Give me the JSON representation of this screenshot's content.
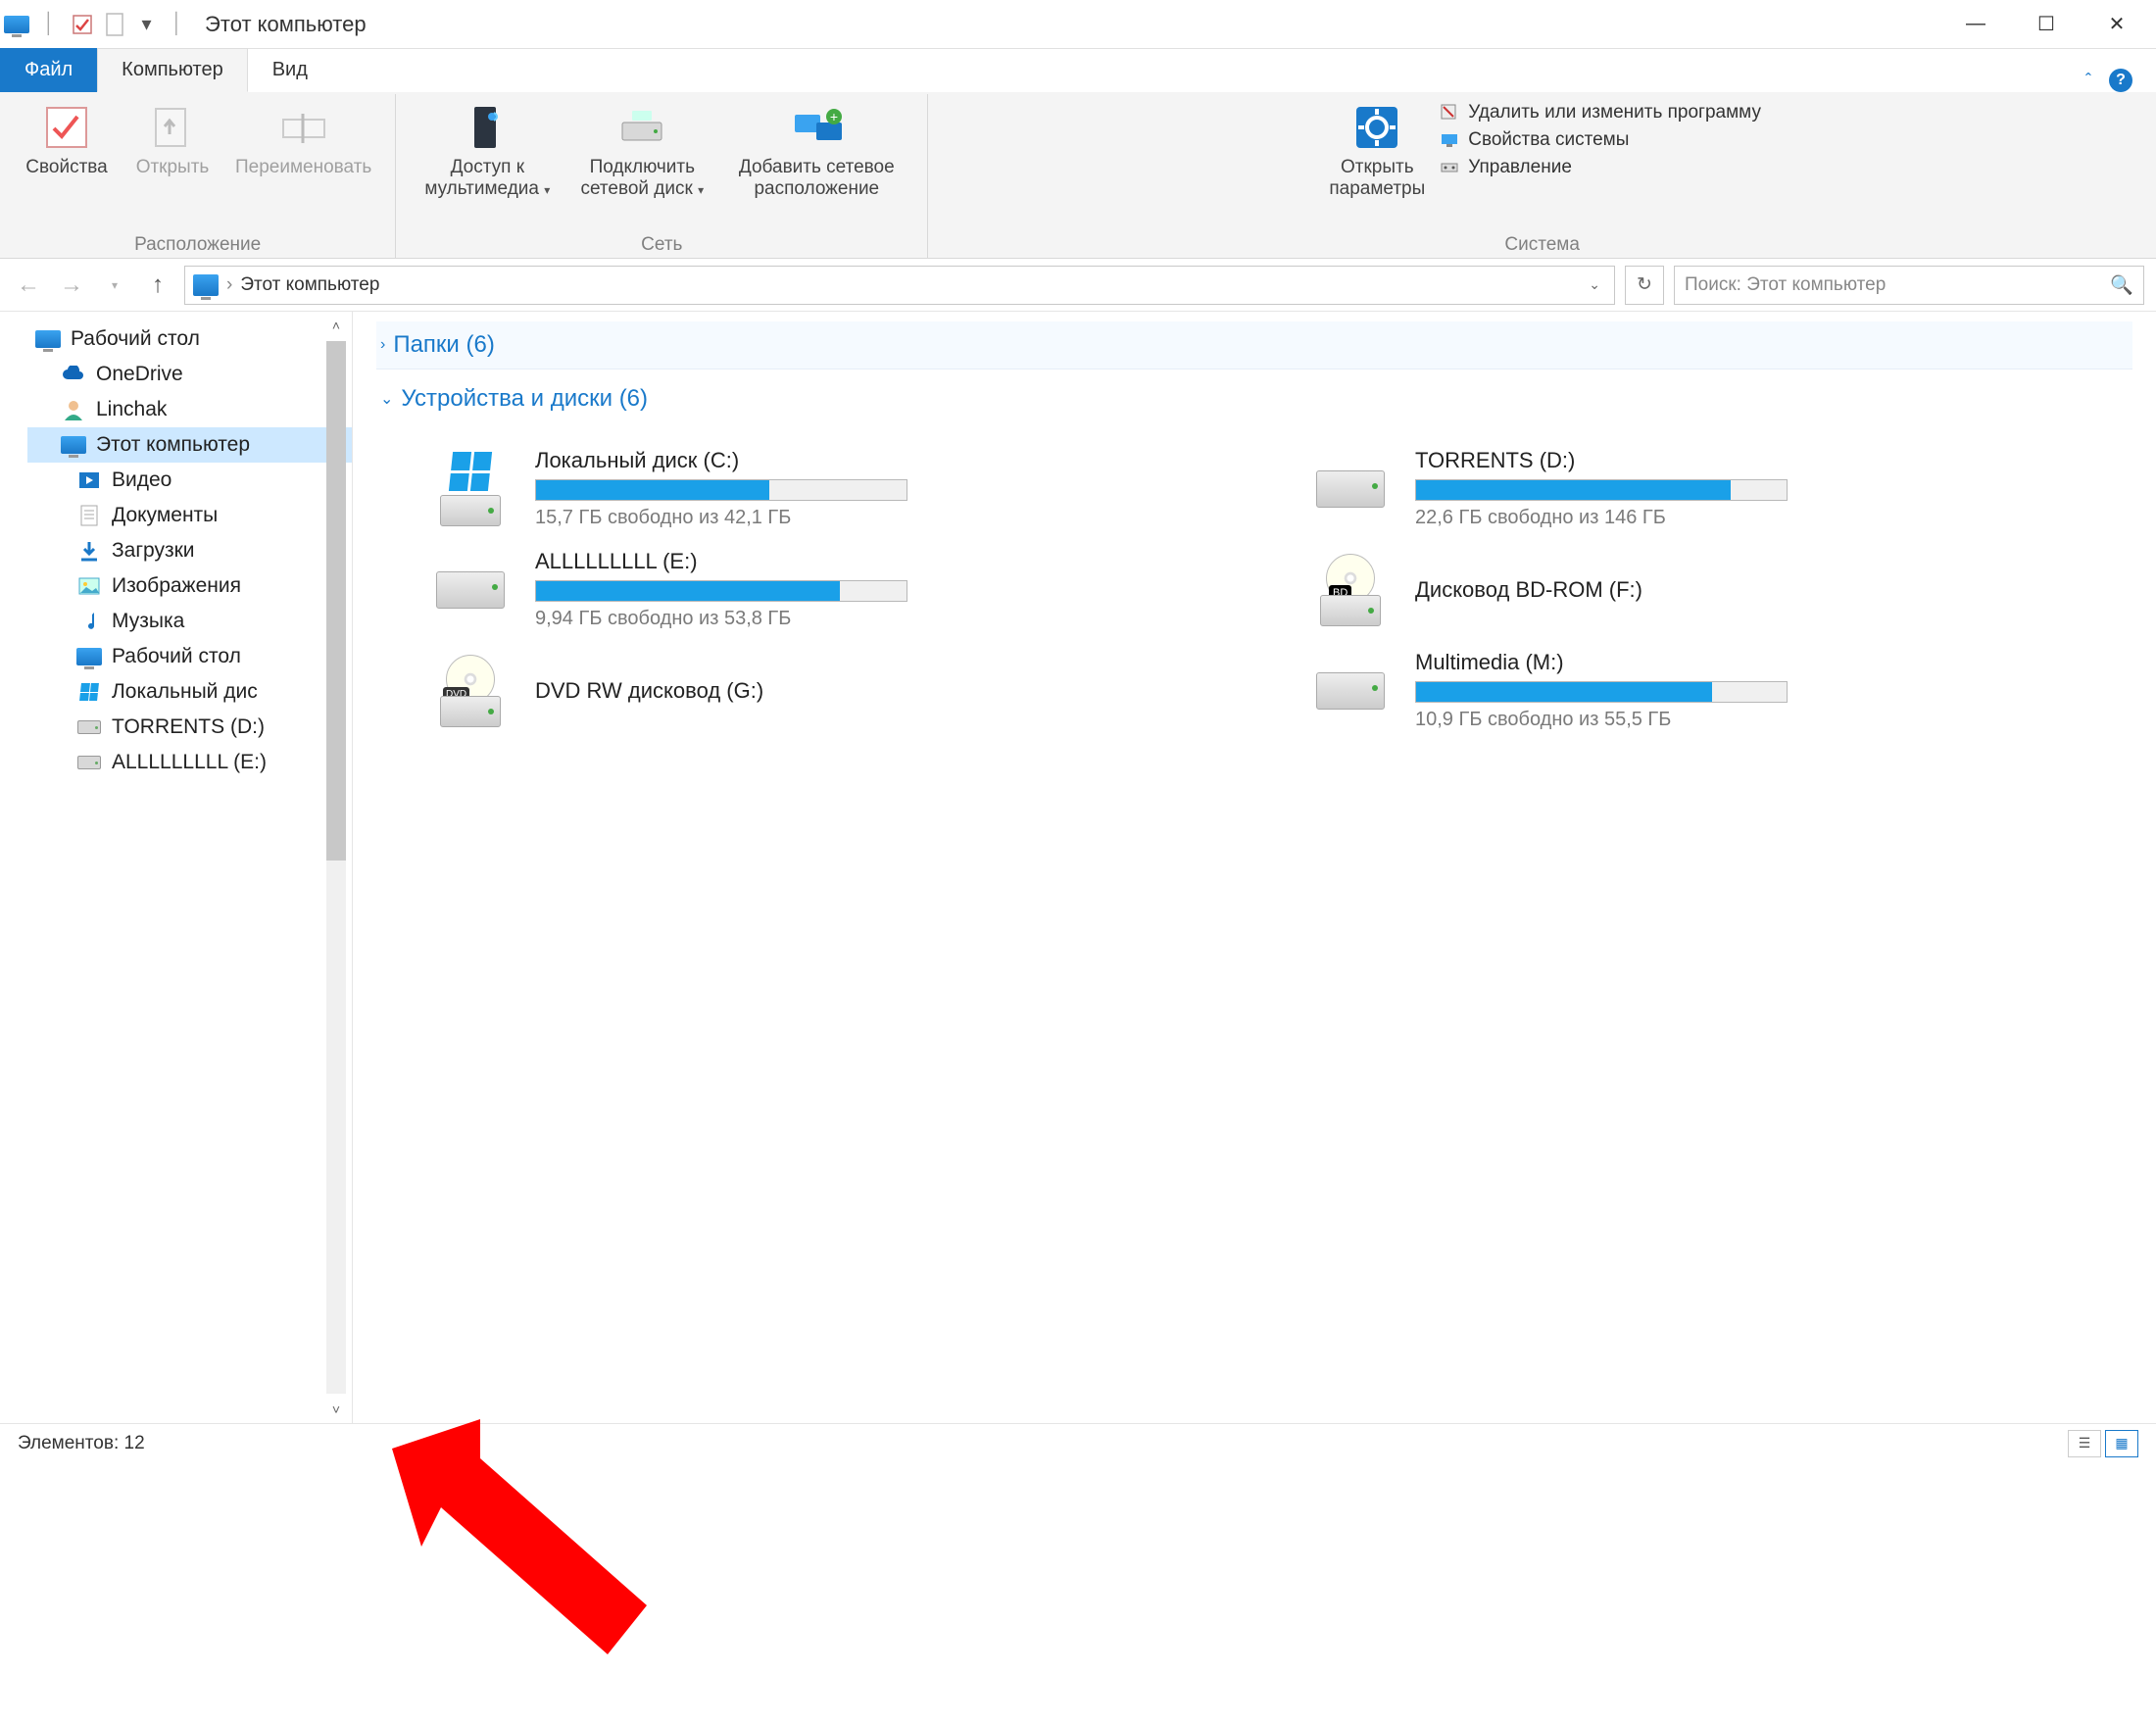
{
  "title": "Этот компьютер",
  "tabs": {
    "file": "Файл",
    "computer": "Компьютер",
    "view": "Вид"
  },
  "ribbon": {
    "group_location": {
      "label": "Расположение",
      "properties": "Свойства",
      "open": "Открыть",
      "rename": "Переименовать"
    },
    "group_network": {
      "label": "Сеть",
      "media_access_1": "Доступ к",
      "media_access_2": "мультимедиа",
      "map_drive_1": "Подключить",
      "map_drive_2": "сетевой диск",
      "add_net_1": "Добавить сетевое",
      "add_net_2": "расположение"
    },
    "group_system": {
      "label": "Система",
      "open_settings_1": "Открыть",
      "open_settings_2": "параметры",
      "uninstall": "Удалить или изменить программу",
      "sys_props": "Свойства системы",
      "manage": "Управление"
    }
  },
  "nav": {
    "breadcrumb": "Этот компьютер",
    "search_placeholder": "Поиск: Этот компьютер"
  },
  "sidebar": {
    "desktop": "Рабочий стол",
    "onedrive": "OneDrive",
    "linchak": "Linchak",
    "thispc": "Этот компьютер",
    "videos": "Видео",
    "documents": "Документы",
    "downloads": "Загрузки",
    "pictures": "Изображения",
    "music": "Музыка",
    "desktop2": "Рабочий стол",
    "localdisc": "Локальный дис",
    "torrents": "TORRENTS (D:)",
    "alll": "ALLLLLLLLL (E:)"
  },
  "content": {
    "folders_header": "Папки (6)",
    "drives_header": "Устройства и диски (6)",
    "drives": [
      {
        "name": "Локальный диск (C:)",
        "sub": "15,7 ГБ свободно из 42,1 ГБ",
        "fill": 63,
        "icon": "win"
      },
      {
        "name": "TORRENTS (D:)",
        "sub": "22,6 ГБ свободно из 146 ГБ",
        "fill": 85,
        "icon": "hdd"
      },
      {
        "name": "ALLLLLLLLL (E:)",
        "sub": "9,94 ГБ свободно из 53,8 ГБ",
        "fill": 82,
        "icon": "hdd"
      },
      {
        "name": "Дисковод BD-ROM (F:)",
        "sub": "",
        "fill": -1,
        "icon": "bd"
      },
      {
        "name": "DVD RW дисковод (G:)",
        "sub": "",
        "fill": -1,
        "icon": "dvd"
      },
      {
        "name": "Multimedia (M:)",
        "sub": "10,9 ГБ свободно из 55,5 ГБ",
        "fill": 80,
        "icon": "hdd"
      }
    ]
  },
  "statusbar": {
    "elements": "Элементов: 12"
  }
}
